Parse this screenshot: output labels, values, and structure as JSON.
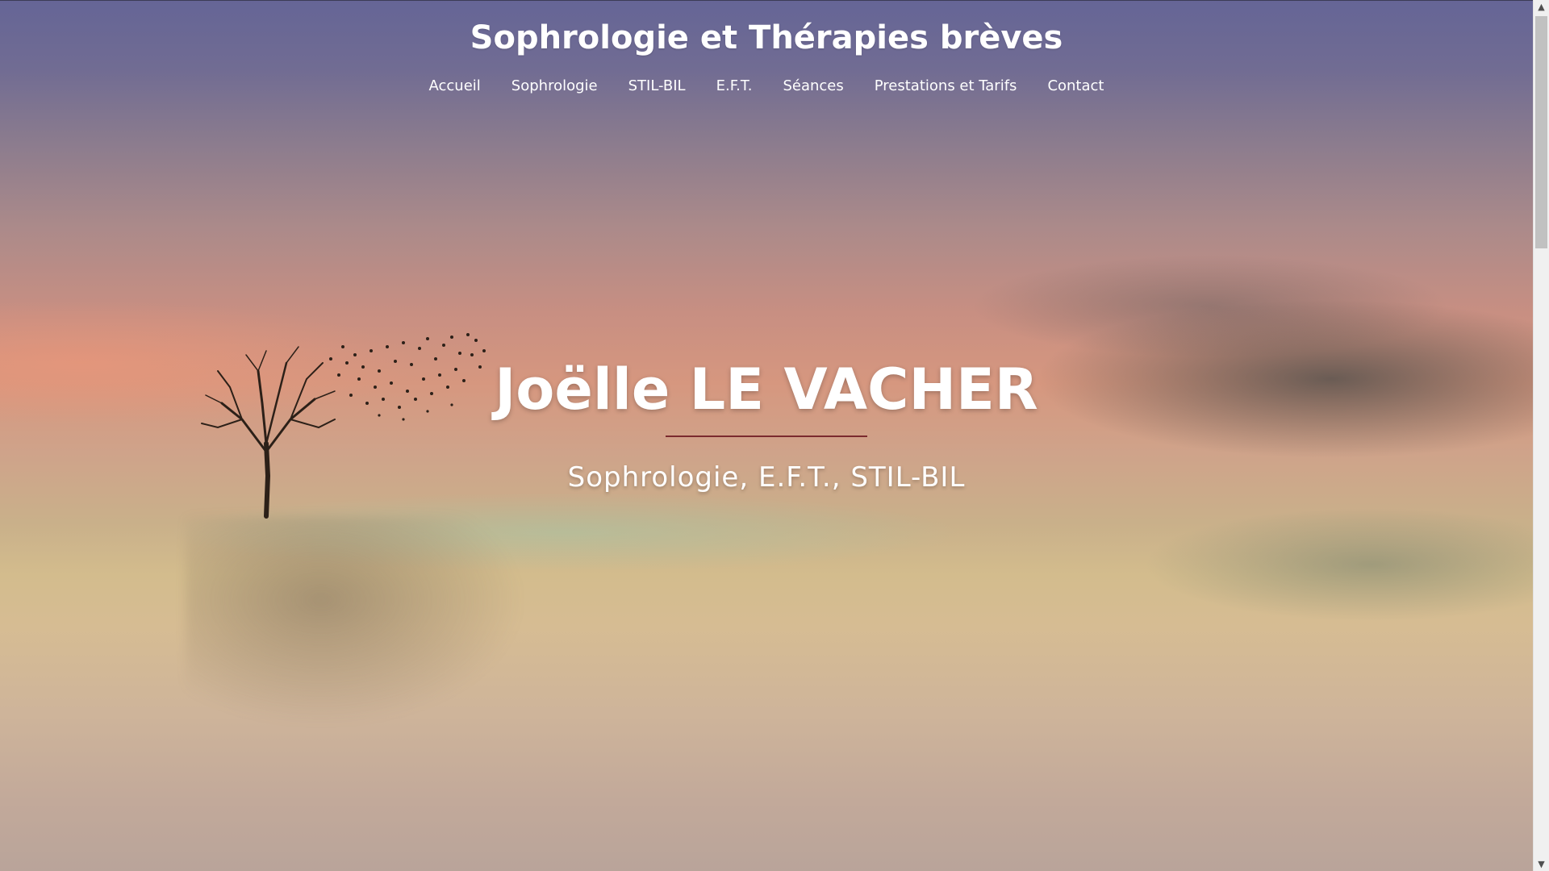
{
  "site": {
    "title": "Sophrologie et Thérapies brèves"
  },
  "nav": {
    "items": [
      {
        "label": "Accueil"
      },
      {
        "label": "Sophrologie"
      },
      {
        "label": "STIL-BIL"
      },
      {
        "label": "E.F.T."
      },
      {
        "label": "Séances"
      },
      {
        "label": "Prestations et Tarifs"
      },
      {
        "label": "Contact"
      }
    ]
  },
  "hero": {
    "headline": "Joëlle LE VACHER",
    "subtitle": "Sophrologie, E.F.T., STIL-BIL"
  },
  "colors": {
    "text": "#ffffff",
    "divider": "#7a2a2e",
    "sky_top": "#656596",
    "sky_mid": "#d6977f",
    "ground": "#d3bc8d"
  },
  "scrollbar": {
    "up_icon": "chevron-up-icon",
    "down_icon": "chevron-down-icon"
  }
}
